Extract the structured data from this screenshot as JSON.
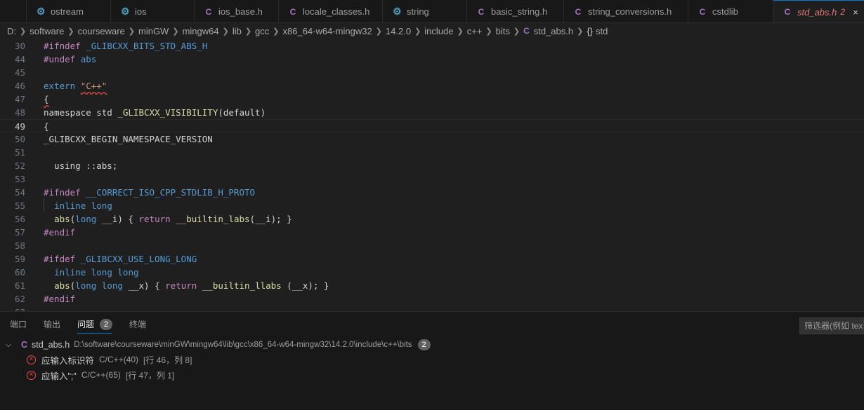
{
  "tabs": [
    {
      "icon": "gear",
      "label": "ostream",
      "width": 120
    },
    {
      "icon": "gear",
      "label": "ios",
      "width": 119
    },
    {
      "icon": "c",
      "label": "ios_base.h",
      "width": 120
    },
    {
      "icon": "c",
      "label": "locale_classes.h",
      "width": 148
    },
    {
      "icon": "gear",
      "label": "string",
      "width": 120
    },
    {
      "icon": "c",
      "label": "basic_string.h",
      "width": 138
    },
    {
      "icon": "c",
      "label": "string_conversions.h",
      "width": 177
    },
    {
      "icon": "c",
      "label": "cstdlib",
      "width": 121
    },
    {
      "icon": "c",
      "label": "std_abs.h",
      "mod": "2",
      "active": true,
      "width": 130
    }
  ],
  "breadcrumb": {
    "parts": [
      "D:",
      "software",
      "courseware",
      "minGW",
      "mingw64",
      "lib",
      "gcc",
      "x86_64-w64-mingw32",
      "14.2.0",
      "include",
      "c++",
      "bits"
    ],
    "file": "std_abs.h",
    "symbol": "std",
    "symbol_icon": "{}",
    "file_icon": "C"
  },
  "editor": {
    "current_line": "49",
    "lines": [
      {
        "n": "30",
        "segs": [
          [
            "pp",
            "#ifndef"
          ],
          [
            "t",
            " "
          ],
          [
            "mac",
            "_GLIBCXX_BITS_STD_ABS_H"
          ]
        ]
      },
      {
        "n": "44",
        "segs": [
          [
            "pp",
            "#undef"
          ],
          [
            "t",
            " "
          ],
          [
            "mac",
            "abs"
          ]
        ]
      },
      {
        "n": "45",
        "segs": []
      },
      {
        "n": "46",
        "segs": [
          [
            "kw",
            "extern"
          ],
          [
            "t",
            " "
          ],
          [
            "strsq",
            "\"C++\""
          ]
        ]
      },
      {
        "n": "47",
        "segs": [
          [
            "sq",
            "{"
          ]
        ]
      },
      {
        "n": "48",
        "segs": [
          [
            "t",
            "namespace std "
          ],
          [
            "fn",
            "_GLIBCXX_VISIBILITY"
          ],
          [
            "t",
            "(default)"
          ]
        ]
      },
      {
        "n": "49",
        "segs": [
          [
            "t",
            "{"
          ]
        ]
      },
      {
        "n": "50",
        "segs": [
          [
            "t",
            "_GLIBCXX_BEGIN_NAMESPACE_VERSION"
          ]
        ]
      },
      {
        "n": "51",
        "segs": []
      },
      {
        "n": "52",
        "segs": [
          [
            "t",
            "  using ::abs;"
          ]
        ]
      },
      {
        "n": "53",
        "segs": []
      },
      {
        "n": "54",
        "segs": [
          [
            "pp",
            "#ifndef"
          ],
          [
            "t",
            " "
          ],
          [
            "mac",
            "__CORRECT_ISO_CPP_STDLIB_H_PROTO"
          ]
        ]
      },
      {
        "n": "55",
        "segs": [
          [
            "t",
            "  "
          ],
          [
            "kw",
            "inline"
          ],
          [
            "t",
            " "
          ],
          [
            "kw",
            "long"
          ]
        ]
      },
      {
        "n": "56",
        "segs": [
          [
            "t",
            "  "
          ],
          [
            "fn",
            "abs"
          ],
          [
            "t",
            "("
          ],
          [
            "kw",
            "long"
          ],
          [
            "t",
            " __i) { "
          ],
          [
            "ctl",
            "return"
          ],
          [
            "t",
            " "
          ],
          [
            "fn",
            "__builtin_labs"
          ],
          [
            "t",
            "(__i); }"
          ]
        ]
      },
      {
        "n": "57",
        "segs": [
          [
            "pp",
            "#endif"
          ]
        ]
      },
      {
        "n": "58",
        "segs": []
      },
      {
        "n": "59",
        "segs": [
          [
            "pp",
            "#ifdef"
          ],
          [
            "t",
            " "
          ],
          [
            "mac",
            "_GLIBCXX_USE_LONG_LONG"
          ]
        ]
      },
      {
        "n": "60",
        "segs": [
          [
            "t",
            "  "
          ],
          [
            "kw",
            "inline"
          ],
          [
            "t",
            " "
          ],
          [
            "kw",
            "long"
          ],
          [
            "t",
            " "
          ],
          [
            "kw",
            "long"
          ]
        ]
      },
      {
        "n": "61",
        "segs": [
          [
            "t",
            "  "
          ],
          [
            "fn",
            "abs"
          ],
          [
            "t",
            "("
          ],
          [
            "kw",
            "long"
          ],
          [
            "t",
            " "
          ],
          [
            "kw",
            "long"
          ],
          [
            "t",
            " __x) { "
          ],
          [
            "ctl",
            "return"
          ],
          [
            "t",
            " "
          ],
          [
            "fn",
            "__builtin_llabs"
          ],
          [
            "t",
            " (__x); }"
          ]
        ]
      },
      {
        "n": "62",
        "segs": [
          [
            "pp",
            "#endif"
          ]
        ]
      },
      {
        "n": "63",
        "segs": []
      }
    ]
  },
  "panel": {
    "tabs": [
      {
        "label": "端口"
      },
      {
        "label": "输出"
      },
      {
        "label": "问题",
        "badge": "2",
        "active": true
      },
      {
        "label": "终端"
      }
    ],
    "filter_placeholder": "筛选器(例如 text",
    "file": {
      "name": "std_abs.h",
      "path": "D:\\software\\courseware\\minGW\\mingw64\\lib\\gcc\\x86_64-w64-mingw32\\14.2.0\\include\\c++\\bits",
      "count": "2"
    },
    "problems": [
      {
        "message": "应输入标识符",
        "source": "C/C++(40)",
        "position": "[行 46，列 8]"
      },
      {
        "message": "应输入\";\"",
        "source": "C/C++(65)",
        "position": "[行 47，列 1]"
      }
    ]
  },
  "colors": {
    "accent": "#0078d4",
    "error": "#f14c4c",
    "keyword": "#569cd6",
    "preprocessor": "#c586c0",
    "function": "#dcdcaa",
    "string": "#ce9178",
    "c_icon": "#a074c4",
    "gear_icon": "#519aba"
  }
}
